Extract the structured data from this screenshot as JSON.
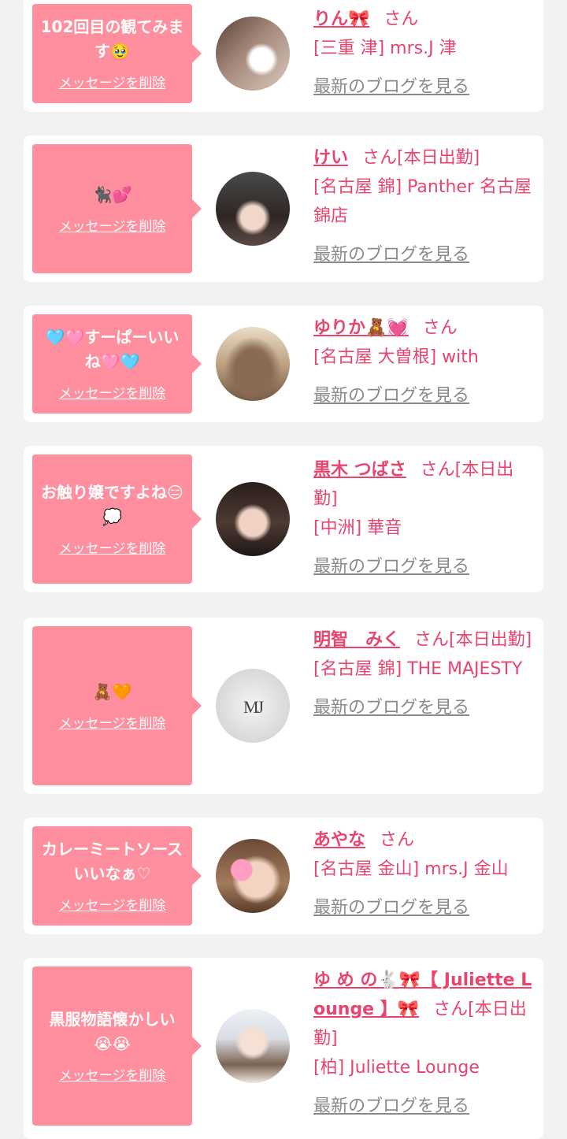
{
  "common": {
    "delete_label": "メッセージを削除",
    "blog_label": "最新のブログを見る"
  },
  "colors": {
    "bubble": "#ff8e9e",
    "name": "#e8456e",
    "blog_link": "#8a8a8a",
    "background": "#f2f2f2"
  },
  "favorites": [
    {
      "message": "102回目の観てみます🥹",
      "name": "りん🎀",
      "honorific": "さん",
      "shop": "[三重 津] mrs.J 津"
    },
    {
      "message": "🐈‍⬛💕",
      "name": "けい",
      "honorific": "さん[本日出勤]",
      "shop": "[名古屋 錦] Panther 名古屋錦店"
    },
    {
      "message": "🩵🩷すーぱーいいね🩷🩵",
      "name": "ゆりか🧸💓",
      "honorific": "さん",
      "shop": "[名古屋 大曽根] with"
    },
    {
      "message": "お触り嬢ですよね😑💭",
      "name": "黒木 つばさ",
      "honorific": "さん[本日出勤]",
      "shop": "[中洲] 華音"
    },
    {
      "message": "🧸🧡",
      "name": "明智　みく",
      "honorific": "さん[本日出勤]",
      "shop": "[名古屋 錦] THE MAJESTY"
    },
    {
      "message": "カレーミートソースいいなぁ♡",
      "name": "あやな",
      "honorific": "さん",
      "shop": "[名古屋 金山] mrs.J 金山"
    },
    {
      "message": "黒服物語懐かしい😭😭",
      "name": "ゆ め の🐇🎀【 Juliette Lounge 】🎀",
      "honorific": "さん[本日出勤]",
      "shop": "[柏] Juliette Lounge"
    }
  ]
}
